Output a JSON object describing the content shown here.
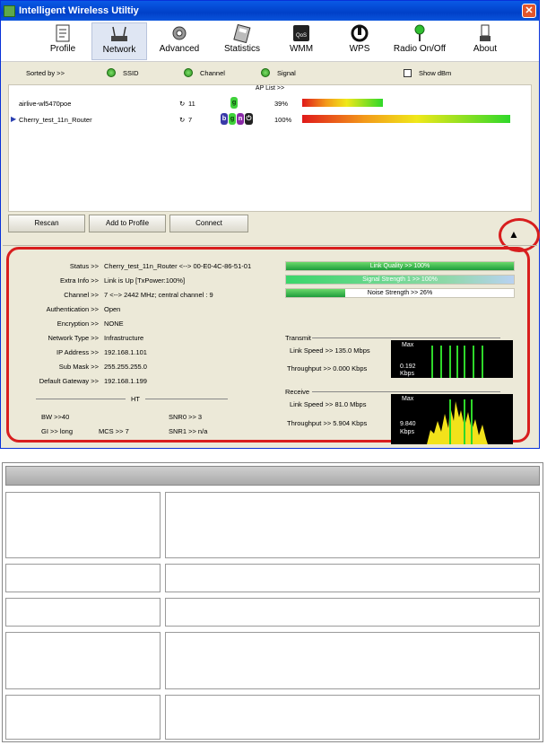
{
  "window": {
    "title": "Intelligent Wireless Utiltiy",
    "close_glyph": "✕"
  },
  "toolbar": {
    "items": [
      {
        "label": "Profile",
        "icon": "profile-icon"
      },
      {
        "label": "Network",
        "icon": "network-icon",
        "active": true
      },
      {
        "label": "Advanced",
        "icon": "advanced-icon"
      },
      {
        "label": "Statistics",
        "icon": "statistics-icon"
      },
      {
        "label": "WMM",
        "icon": "wmm-icon"
      },
      {
        "label": "WPS",
        "icon": "wps-icon"
      },
      {
        "label": "Radio On/Off",
        "icon": "radio-icon"
      },
      {
        "label": "About",
        "icon": "about-icon"
      }
    ]
  },
  "sort": {
    "label": "Sorted by >>",
    "ssid": "SSID",
    "channel": "Channel",
    "signal": "Signal",
    "show_dbm": "Show dBm"
  },
  "ap_list": {
    "title": "AP List >>",
    "rows": [
      {
        "ssid": "airlive-wl5470poe",
        "channel": "11",
        "modes": "g",
        "signal": "39%",
        "signal_fraction": 0.39,
        "selected": false
      },
      {
        "ssid": "Cherry_test_11n_Router",
        "channel": "7",
        "modes": "bgn",
        "signal": "100%",
        "signal_fraction": 1.0,
        "selected": true
      }
    ]
  },
  "buttons": {
    "rescan": "Rescan",
    "add_to_profile": "Add to Profile",
    "connect": "Connect",
    "collapse_glyph": "▲"
  },
  "info": {
    "status_label": "Status >>",
    "status_value": "Cherry_test_11n_Router <--> 00-E0-4C-86-51-01",
    "extra_label": "Extra Info >>",
    "extra_value": "Link is Up [TxPower:100%]",
    "channel_label": "Channel >>",
    "channel_value": "7 <--> 2442 MHz; central channel : 9",
    "auth_label": "Authentication >>",
    "auth_value": "Open",
    "enc_label": "Encryption >>",
    "enc_value": "NONE",
    "nettype_label": "Network Type >>",
    "nettype_value": "Infrastructure",
    "ip_label": "IP Address >>",
    "ip_value": "192.168.1.101",
    "mask_label": "Sub Mask >>",
    "mask_value": "255.255.255.0",
    "gw_label": "Default Gateway >>",
    "gw_value": "192.168.1.199",
    "ht_title": "HT",
    "bw": "BW >>40",
    "gi": "GI >> long",
    "mcs": "MCS >>  7",
    "snr0": "SNR0 >>  3",
    "snr1": "SNR1 >> n/a"
  },
  "quality": {
    "link_quality": "Link Quality >> 100%",
    "link_quality_fraction": 1.0,
    "signal_strength": "Signal Strength 1 >> 100%",
    "signal_strength_fraction": 1.0,
    "noise_strength": "Noise Strength >> 26%",
    "noise_fraction": 0.26
  },
  "transmit": {
    "title": "Transmit",
    "link_speed": "Link Speed >>  135.0 Mbps",
    "throughput": "Throughput >> 0.000 Kbps",
    "max": "Max",
    "graph_value": "0.192",
    "graph_unit": "Kbps"
  },
  "receive": {
    "title": "Receive",
    "link_speed": "Link Speed >> 81.0 Mbps",
    "throughput": "Throughput >> 5.904 Kbps",
    "max": "Max",
    "graph_value": "9.840",
    "graph_unit": "Kbps"
  },
  "colors": {
    "accent": "#0a5ae6",
    "highlight": "#d81e1e",
    "good": "#2fd82a"
  }
}
